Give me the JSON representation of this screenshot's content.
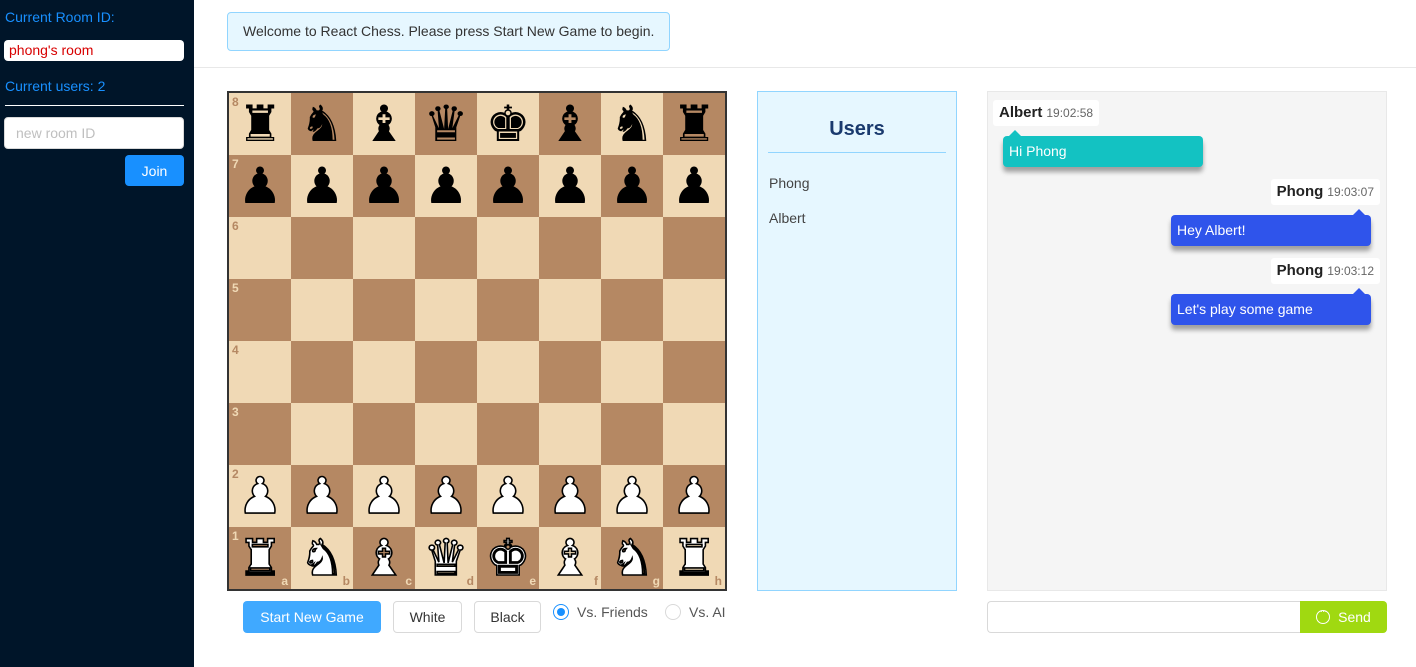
{
  "sidebar": {
    "current_room_label": "Current Room ID:",
    "current_room_id": "phong's room",
    "current_users_label": "Current users: 2",
    "room_input_placeholder": "new room ID",
    "join_label": "Join"
  },
  "header": {
    "welcome_message": "Welcome to React Chess. Please press Start New Game to begin."
  },
  "board": {
    "ranks": [
      "8",
      "7",
      "6",
      "5",
      "4",
      "3",
      "2",
      "1"
    ],
    "files": [
      "a",
      "b",
      "c",
      "d",
      "e",
      "f",
      "g",
      "h"
    ],
    "colors": {
      "light": "#f0d9b5",
      "dark": "#b58863"
    },
    "position": [
      [
        "bR",
        "bN",
        "bB",
        "bQ",
        "bK",
        "bB",
        "bN",
        "bR"
      ],
      [
        "bP",
        "bP",
        "bP",
        "bP",
        "bP",
        "bP",
        "bP",
        "bP"
      ],
      [
        "",
        "",
        "",
        "",
        "",
        "",
        "",
        ""
      ],
      [
        "",
        "",
        "",
        "",
        "",
        "",
        "",
        ""
      ],
      [
        "",
        "",
        "",
        "",
        "",
        "",
        "",
        ""
      ],
      [
        "",
        "",
        "",
        "",
        "",
        "",
        "",
        ""
      ],
      [
        "wP",
        "wP",
        "wP",
        "wP",
        "wP",
        "wP",
        "wP",
        "wP"
      ],
      [
        "wR",
        "wN",
        "wB",
        "wQ",
        "wK",
        "wB",
        "wN",
        "wR"
      ]
    ]
  },
  "controls": {
    "start_label": "Start New Game",
    "white_label": "White",
    "black_label": "Black",
    "mode_options": [
      "Vs. Friends",
      "Vs. AI"
    ],
    "selected_mode": "Vs. Friends"
  },
  "users": {
    "title": "Users",
    "list": [
      "Phong",
      "Albert"
    ]
  },
  "chat": {
    "messages": [
      {
        "user": "Albert",
        "time": "19:02:58",
        "text": "Hi Phong",
        "side": "left"
      },
      {
        "user": "Phong",
        "time": "19:03:07",
        "text": "Hey Albert!",
        "side": "right"
      },
      {
        "user": "Phong",
        "time": "19:03:12",
        "text": "Let's play some game",
        "side": "right"
      }
    ],
    "input_value": "",
    "send_label": "Send",
    "send_icon": "message-icon"
  },
  "colors": {
    "sidebar_bg": "#001529",
    "accent_blue": "#1890ff",
    "teal_bubble": "#13c2c2",
    "blue_bubble": "#2f54eb",
    "send_green": "#a0d911"
  }
}
